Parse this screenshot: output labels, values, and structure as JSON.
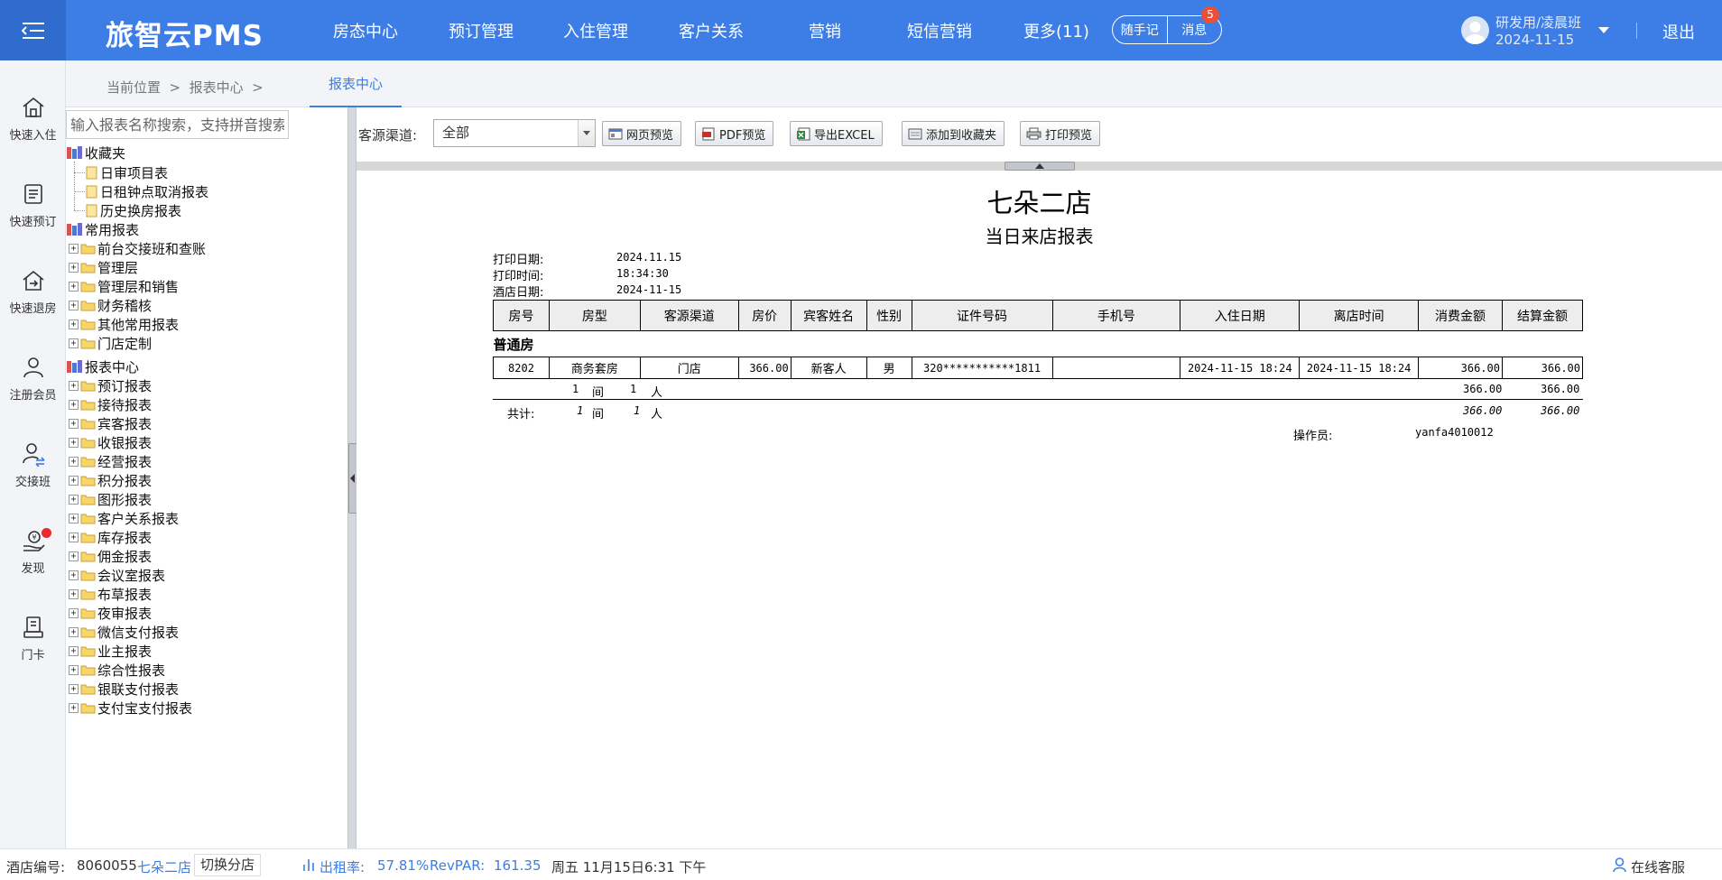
{
  "app": {
    "title": "旅智云PMS",
    "nav": [
      "房态中心",
      "预订管理",
      "入住管理",
      "客户关系",
      "营销",
      "短信营销",
      "更多(11)"
    ],
    "notes_label": "随手记",
    "messages_label": "消息",
    "message_count": "5",
    "user_name": "研发用/凌晨班",
    "user_date": "2024-11-15",
    "logout_label": "退出",
    "accent_color": "#3c7de6"
  },
  "sidebar": {
    "items": [
      {
        "label": "快速入住",
        "icon": "home-icon"
      },
      {
        "label": "快速预订",
        "icon": "booking-icon"
      },
      {
        "label": "快速退房",
        "icon": "checkout-icon"
      },
      {
        "label": "注册会员",
        "icon": "member-icon"
      },
      {
        "label": "交接班",
        "icon": "handover-icon"
      },
      {
        "label": "发现",
        "icon": "discover-icon"
      },
      {
        "label": "门卡",
        "icon": "door-card-icon"
      }
    ]
  },
  "breadcrumb": {
    "text": "当前位置  >  报表中心  >",
    "active_tab": "报表中心"
  },
  "tree": {
    "search_placeholder": "输入报表名称搜索，支持拼音搜索",
    "favorites_label": "收藏夹",
    "favorites": [
      "日审项目表",
      "日租钟点取消报表",
      "历史换房报表"
    ],
    "common_label": "常用报表",
    "common": [
      "前台交接班和查账",
      "管理层",
      "管理层和销售",
      "财务稽核",
      "其他常用报表",
      "门店定制"
    ],
    "center_label": "报表中心",
    "center": [
      "预订报表",
      "接待报表",
      "宾客报表",
      "收银报表",
      "经营报表",
      "积分报表",
      "图形报表",
      "客户关系报表",
      "库存报表",
      "佣金报表",
      "会议室报表",
      "布草报表",
      "夜审报表",
      "微信支付报表",
      "业主报表",
      "综合性报表",
      "银联支付报表",
      "支付宝支付报表"
    ]
  },
  "toolbar": {
    "source_label": "客源渠道:",
    "source_value": "全部",
    "buttons": [
      "网页预览",
      "PDF预览",
      "导出EXCEL",
      "添加到收藏夹",
      "打印预览"
    ]
  },
  "report": {
    "hotel_name": "七朵二店",
    "title": "当日来店报表",
    "meta": [
      {
        "label": "打印日期:",
        "value": "2024.11.15"
      },
      {
        "label": "打印时间:",
        "value": "18:34:30"
      },
      {
        "label": "酒店日期:",
        "value": "2024-11-15"
      }
    ],
    "columns": [
      "房号",
      "房型",
      "客源渠道",
      "房价",
      "宾客姓名",
      "性别",
      "证件号码",
      "手机号",
      "入住日期",
      "离店时间",
      "消费金额",
      "结算金额"
    ],
    "group_label": "普通房",
    "rows": [
      [
        "8202",
        "商务套房",
        "门店",
        "366.00",
        "新客人",
        "男",
        "320***********1811",
        "",
        "2024-11-15 18:24",
        "2024-11-15 18:24",
        "366.00",
        "366.00"
      ]
    ],
    "subtotal": {
      "rooms": "1",
      "room_unit": "间",
      "people": "1",
      "people_unit": "人",
      "consume": "366.00",
      "settle": "366.00"
    },
    "total": {
      "label": "共计:",
      "rooms": "1",
      "room_unit": "间",
      "people": "1",
      "people_unit": "人",
      "consume": "366.00",
      "settle": "366.00"
    },
    "operator_label": "操作员:",
    "operator": "yanfa4010012"
  },
  "status": {
    "hotel_code_label": "酒店编号:",
    "hotel_code": "8060055",
    "hotel_name": "七朵二店",
    "switch_label": "切换分店",
    "occupancy_label": "出租率:",
    "occupancy": "57.81%",
    "revpar_label": "RevPAR:",
    "revpar": "161.35",
    "datetime": "周五 11月15日6:31 下午",
    "service_label": "在线客服"
  }
}
